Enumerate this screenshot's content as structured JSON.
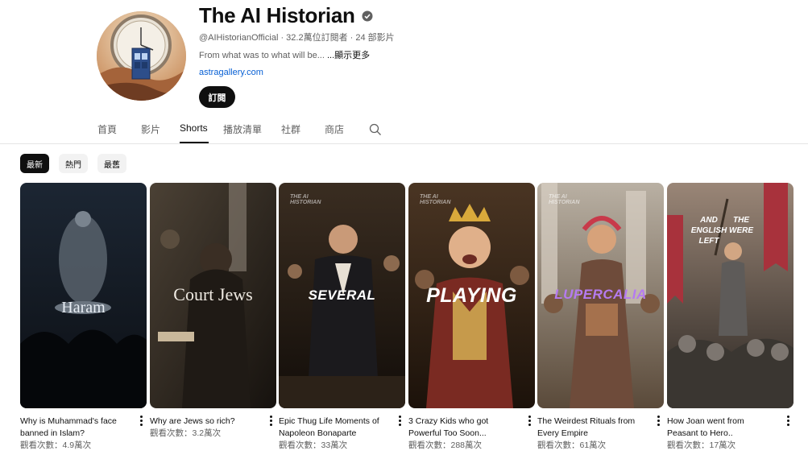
{
  "channel": {
    "name": "The AI Historian",
    "handle": "@AIHistorianOfficial",
    "stats": "@AIHistorianOfficial · 32.2萬位訂閱者 · 24 部影片",
    "description": "From what was to what will be... ",
    "description_more": "...顯示更多",
    "link": "astragallery.com",
    "subscribe_label": "訂閱",
    "verified_icon": "verified-check-icon"
  },
  "tabs": [
    {
      "label": "首頁",
      "active": false
    },
    {
      "label": "影片",
      "active": false
    },
    {
      "label": "Shorts",
      "active": true
    },
    {
      "label": "播放清單",
      "active": false
    },
    {
      "label": "社群",
      "active": false
    },
    {
      "label": "商店",
      "active": false
    }
  ],
  "search_icon": "search-icon",
  "chips": [
    {
      "label": "最新",
      "active": true
    },
    {
      "label": "熱門",
      "active": false
    },
    {
      "label": "最舊",
      "active": false
    }
  ],
  "shorts": [
    {
      "overlay_text": "Haram",
      "title": "Why is Muhammad's face banned in Islam?",
      "views": "觀看次數：4.9萬次"
    },
    {
      "overlay_text": "Court Jews",
      "title": "Why are Jews so rich?",
      "views": "觀看次數：3.2萬次"
    },
    {
      "overlay_text": "SEVERAL",
      "brand_line1": "THE AI",
      "brand_line2": "HISTORIAN",
      "title": "Epic Thug Life Moments of Napoleon Bonaparte",
      "views": "觀看次數：33萬次"
    },
    {
      "overlay_text": "PLAYING",
      "brand_line1": "THE AI",
      "brand_line2": "HISTORIAN",
      "title": "3 Crazy Kids who got Powerful Too Soon...",
      "views": "觀看次數：288萬次"
    },
    {
      "overlay_text": "LUPERCALIA",
      "brand_line1": "THE AI",
      "brand_line2": "HISTORIAN",
      "title": "The Weirdest Rituals from Every Empire",
      "views": "觀看次數：61萬次"
    },
    {
      "overlay_text": "AND ENGLISH LEFT",
      "overlay_text_2": "THE WERE",
      "title": "How Joan went from Peasant to Hero..",
      "views": "觀看次數：17萬次"
    }
  ],
  "colors": {
    "text_primary": "#0f0f0f",
    "text_secondary": "#606060",
    "link": "#065fd4",
    "lupercalia_text": "#b57bf0"
  }
}
